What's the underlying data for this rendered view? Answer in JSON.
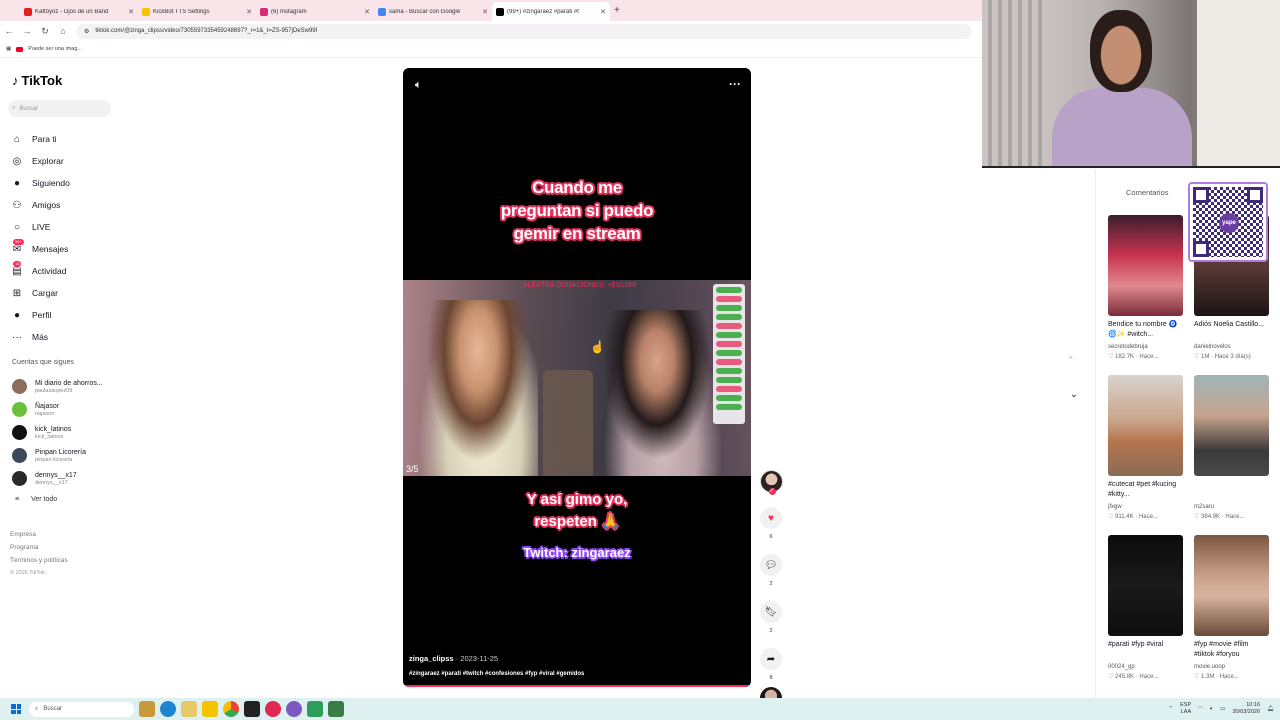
{
  "browser": {
    "tabs": [
      {
        "title": "Kattoyoz - Ojos de un Band",
        "icon_color": "#e02020",
        "active": false
      },
      {
        "title": "KickBot TTS Settings",
        "icon_color": "#f5c400",
        "active": false
      },
      {
        "title": "(6) Instagram",
        "icon_color": "#d62976",
        "active": false
      },
      {
        "title": "sama - Buscar con Google",
        "icon_color": "#4285f4",
        "active": false
      },
      {
        "title": "(99+) #zingaraez #parati #t",
        "icon_color": "#000000",
        "active": true
      }
    ],
    "url": "tiktok.com/@zinga_clipss/video/7305597335459248697?_r=1&_t=ZS-957jDeSw99I",
    "bookmark": "Puede ser una imag..."
  },
  "sidebar": {
    "logo": "TikTok",
    "search_placeholder": "Buscar",
    "nav": [
      {
        "label": "Para ti",
        "icon": "home-icon",
        "glyph": "⌂"
      },
      {
        "label": "Explorar",
        "icon": "compass-icon",
        "glyph": "◎"
      },
      {
        "label": "Siguiendo",
        "icon": "following-icon",
        "glyph": "●"
      },
      {
        "label": "Amigos",
        "icon": "friends-icon",
        "glyph": "⚇"
      },
      {
        "label": "LIVE",
        "icon": "live-icon",
        "glyph": "○"
      },
      {
        "label": "Mensajes",
        "icon": "messages-icon",
        "glyph": "✉",
        "badge": "99+"
      },
      {
        "label": "Actividad",
        "icon": "activity-icon",
        "glyph": "▤",
        "badge": "18"
      },
      {
        "label": "Cargar",
        "icon": "upload-icon",
        "glyph": "⊞"
      },
      {
        "label": "Perfil",
        "icon": "profile-icon",
        "glyph": "●"
      },
      {
        "label": "Más",
        "icon": "more-icon",
        "glyph": "···"
      }
    ],
    "following_title": "Cuentas que sigues",
    "following": [
      {
        "name": "Mi diario de ahorros...",
        "handle": "paulasaopez09",
        "color": "#8a6d5a"
      },
      {
        "name": "Ñajasor",
        "handle": "najasorr",
        "color": "#6bbf3a"
      },
      {
        "name": "kick_latinos",
        "handle": "kick_latinos",
        "color": "#111111"
      },
      {
        "name": "Pinpan Licorería",
        "handle": "pinpan licoreria",
        "color": "#3a4a5a"
      },
      {
        "name": "dennys__x17",
        "handle": "dennys__x17",
        "color": "#2a2a2a"
      }
    ],
    "see_all": "Ver todo",
    "footer": [
      "Empresa",
      "Programa",
      "Términos y políticas"
    ],
    "copyright": "© 2026 TikTok"
  },
  "video": {
    "caption_top": [
      "Cuando me",
      "preguntan si puedo",
      "gemir en stream"
    ],
    "scene_header": "ALERTAS DONACIONES: +$10,000",
    "slide_counter": "3/5",
    "caption_mid": [
      "Y así gimo yo,",
      "respeten 🙏"
    ],
    "caption_twitch": "Twitch: zingaraez",
    "author": "zinga_clipss",
    "date": "2023-11-25",
    "tags": "#zingaraez #parati #twitch #confesiones #fyp #viral #gemidos"
  },
  "actions": {
    "likes": "6",
    "comments": "2",
    "saves": "2",
    "shares": "8"
  },
  "right_panel": {
    "title": "Comentarios",
    "qr_label": "yape",
    "cards": [
      {
        "title": "Bendice tu nombre 🧿🌀✨ #witch...",
        "author": "secretodebruja",
        "stats": "182.7K · Hace...",
        "thumb": "linear-gradient(180deg,#3b1e2e 0%,#c8334f 40%,#e08a8f 70%,#7a2b3a 100%)"
      },
      {
        "title": "Adiós Noelia Castillo...",
        "author": "danielnovelos",
        "stats": "1M · Hace 3 día(s)",
        "thumb": "linear-gradient(180deg,#22181a 0%,#5a3a36 50%,#1c1414 100%)"
      },
      {
        "title": "#cutecat #pet #kucing #kitty...",
        "author": "jfxgw",
        "stats": "911.4K · Hace...",
        "thumb": "linear-gradient(180deg,#d8d4cf 0%,#c9a58a 45%,#b57650 65%,#8a6b55 100%)"
      },
      {
        "title": "",
        "author": "m2saru",
        "stats": "384.9K · Hace...",
        "thumb": "linear-gradient(180deg,#9fb4b8 0%,#c7a48e 40%,#3b3a3a 75%,#4a4a4a 100%)"
      },
      {
        "title": "#parati #fyp #viral",
        "author": "00024_gp",
        "stats": "245.8K · Hace...",
        "thumb": "linear-gradient(180deg,#0b0b0b 0%,#1a1a1a 50%,#0e0e0e 100%)"
      },
      {
        "title": "#fyp #movie #film #tiktok #foryou",
        "author": "movie.uoop",
        "stats": "1.3M · Hace...",
        "thumb": "linear-gradient(180deg,#7a5640 0%,#c8a08a 40%,#d8b5a0 60%,#6a4a3a 100%)"
      }
    ]
  },
  "taskbar": {
    "search_placeholder": "Buscar",
    "lang": "ESP",
    "lang2": "LAA",
    "time": "10:16",
    "date": "30/03/2026"
  }
}
